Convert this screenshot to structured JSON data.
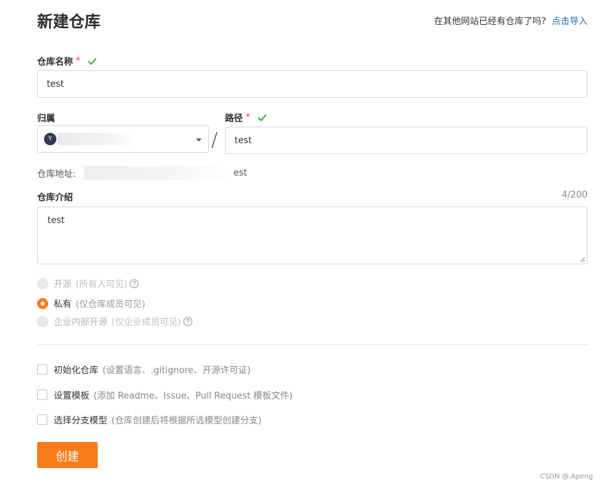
{
  "header": {
    "title": "新建仓库",
    "import_prompt": "在其他网站已经有仓库了吗?",
    "import_link": "点击导入"
  },
  "form": {
    "repo_name": {
      "label": "仓库名称",
      "required_mark": "*",
      "value": "test"
    },
    "owner": {
      "label": "归属",
      "avatar_initial": "Y"
    },
    "path": {
      "label": "路径",
      "required_mark": "*",
      "value": "test"
    },
    "separator": "/",
    "address": {
      "label": "仓库地址:",
      "visible_suffix": "est"
    },
    "description": {
      "label": "仓库介绍",
      "counter": "4/200",
      "value": "test"
    },
    "visibility": [
      {
        "label": "开源",
        "hint": "(所有人可见)",
        "state": "disabled"
      },
      {
        "label": "私有",
        "hint": "(仅仓库成员可见)",
        "state": "checked"
      },
      {
        "label": "企业内部开源",
        "hint": "(仅企业成员可见)",
        "state": "disabled"
      }
    ],
    "options": [
      {
        "label": "初始化仓库",
        "hint": "(设置语言、.gitignore、开源许可证)"
      },
      {
        "label": "设置模板",
        "hint": "(添加 Readme、Issue、Pull Request 模板文件)"
      },
      {
        "label": "选择分支模型",
        "hint": "(仓库创建后将根据所选模型创建分支)"
      }
    ],
    "submit_label": "创建"
  },
  "watermark": "CSDN @.Apeng",
  "colors": {
    "accent": "#fa7a18",
    "link": "#1f6fb2",
    "success": "#4caf50",
    "required": "#e53935"
  }
}
